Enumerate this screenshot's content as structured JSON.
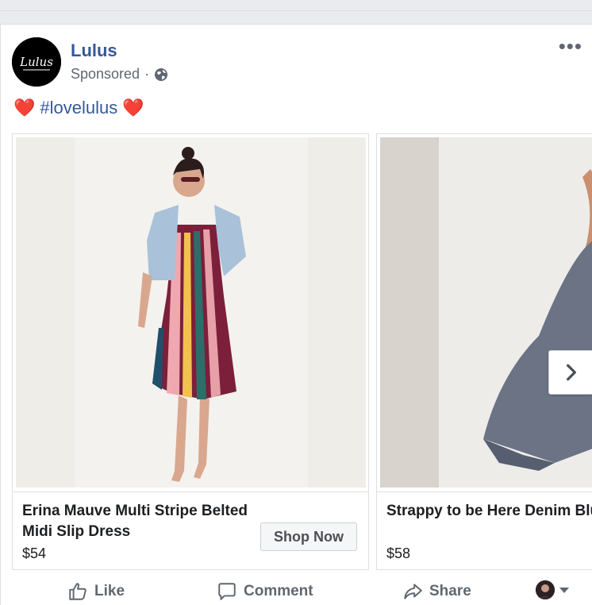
{
  "post": {
    "page_name": "Lulus",
    "logo_text": "Lulus",
    "sponsored_label": "Sponsored",
    "separator": "·",
    "caption_heart_left": "❤️",
    "caption_hashtag": "#lovelulus",
    "caption_heart_right": "❤️",
    "more_label": "•••"
  },
  "carousel": {
    "items": [
      {
        "title": "Erina Mauve Multi Stripe Belted Midi Slip Dress",
        "price": "$54",
        "cta": "Shop Now"
      },
      {
        "title": "Strappy to be Here Denim Blue Maxi Dress",
        "price": "$58"
      }
    ]
  },
  "actions": {
    "like": "Like",
    "comment": "Comment",
    "share": "Share"
  },
  "colors": {
    "link": "#365899",
    "muted": "#606770",
    "border": "#dddfe2"
  }
}
